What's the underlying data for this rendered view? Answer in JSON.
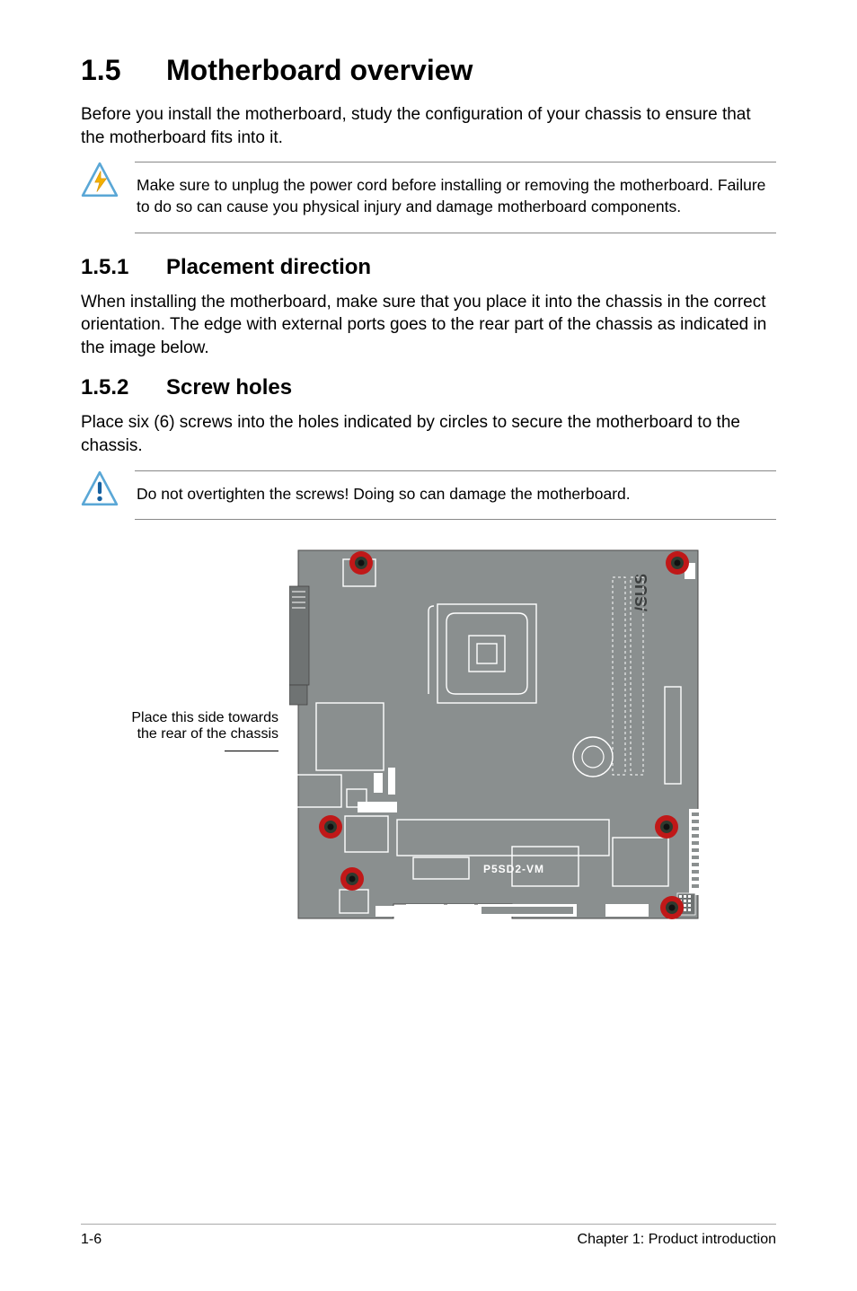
{
  "section": {
    "number": "1.5",
    "title": "Motherboard overview",
    "intro": "Before you install the motherboard, study the configuration of your chassis to ensure that the motherboard fits into it."
  },
  "warning": {
    "text": "Make sure to unplug the power cord before installing or removing the motherboard. Failure to do so can cause you physical injury and damage motherboard components."
  },
  "sub1": {
    "number": "1.5.1",
    "title": "Placement direction",
    "body": "When installing the motherboard, make sure that you place it into the chassis in the correct orientation. The edge with external ports goes to the rear part of the chassis as indicated in the image below."
  },
  "sub2": {
    "number": "1.5.2",
    "title": "Screw holes",
    "body": "Place six (6) screws into the holes indicated by circles to secure the motherboard to the chassis."
  },
  "caution": {
    "text": "Do not overtighten the screws! Doing so can damage the motherboard."
  },
  "diagram": {
    "side_label_line1": "Place this side towards",
    "side_label_line2": "the rear of the chassis",
    "model": "P5SD2-VM"
  },
  "footer": {
    "left": "1-6",
    "right": "Chapter 1: Product introduction"
  }
}
